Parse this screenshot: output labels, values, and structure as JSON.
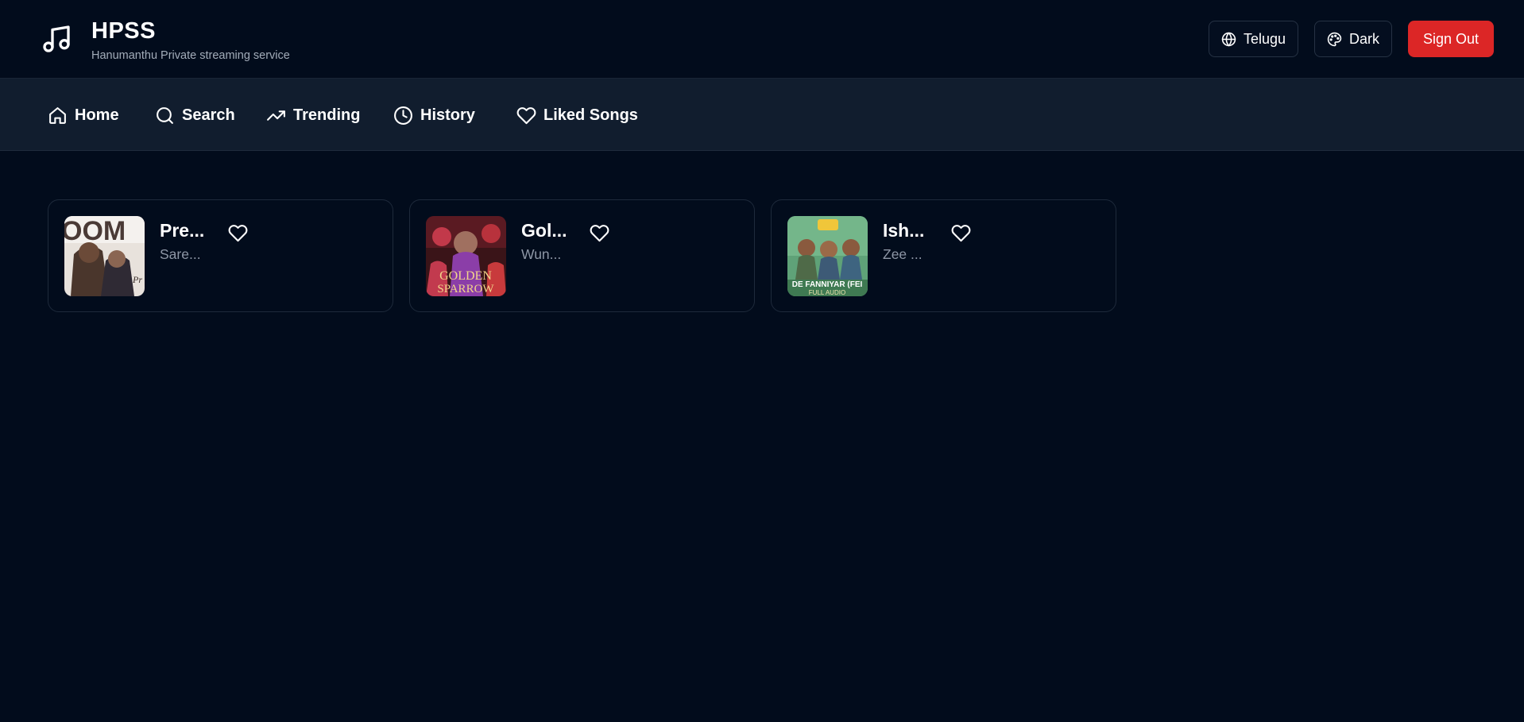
{
  "app": {
    "title": "HPSS",
    "subtitle": "Hanumanthu Private streaming service"
  },
  "header": {
    "language_label": "Telugu",
    "theme_label": "Dark",
    "signout_label": "Sign Out",
    "signout_color": "#dc2626"
  },
  "nav": {
    "items": [
      {
        "label": "Home",
        "icon": "home-icon"
      },
      {
        "label": "Search",
        "icon": "search-icon"
      },
      {
        "label": "Trending",
        "icon": "trending-up-icon"
      },
      {
        "label": "History",
        "icon": "clock-icon"
      },
      {
        "label": "Liked Songs",
        "icon": "heart-icon"
      }
    ]
  },
  "songs": [
    {
      "title": "Pre...",
      "artist": "Sare...",
      "liked": false
    },
    {
      "title": "Gol...",
      "artist": "Wun...",
      "liked": false
    },
    {
      "title": "Ish...",
      "artist": "Zee ...",
      "liked": false
    }
  ],
  "colors": {
    "background": "#020c1c",
    "nav_background": "#111d2e",
    "accent_danger": "#dc2626"
  }
}
